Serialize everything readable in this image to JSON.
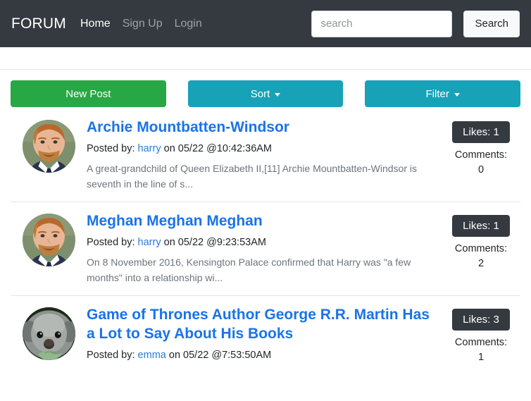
{
  "navbar": {
    "brand": "FORUM",
    "links": [
      {
        "label": "Home",
        "state": "active"
      },
      {
        "label": "Sign Up",
        "state": "muted"
      },
      {
        "label": "Login",
        "state": "muted"
      }
    ],
    "search": {
      "placeholder": "search",
      "value": "",
      "button_label": "Search"
    },
    "background_color": "#343a40"
  },
  "actions": {
    "new_post_label": "New Post",
    "sort_label": "Sort",
    "filter_label": "Filter",
    "new_post_color": "#28a745",
    "sort_color": "#17a2b8",
    "filter_color": "#17a2b8"
  },
  "posts": [
    {
      "title": "Archie Mountbatten-Windsor",
      "posted_by_label": "Posted by:",
      "author": "harry",
      "date_text": "on 05/22 @10:42:36AM",
      "excerpt": "A great-grandchild of Queen Elizabeth II,[11] Archie Mountbatten-Windsor is seventh in the line of s...",
      "likes_label": "Likes: 1",
      "comments_label": "Comments:",
      "comments_count": "0",
      "avatar": "prince-harry-photo"
    },
    {
      "title": "Meghan Meghan Meghan",
      "posted_by_label": "Posted by:",
      "author": "harry",
      "date_text": "on 05/22 @9:23:53AM",
      "excerpt": "On 8 November 2016, Kensington Palace confirmed that Harry was \"a few months\" into a relationship wi...",
      "likes_label": "Likes: 1",
      "comments_label": "Comments:",
      "comments_count": "2",
      "avatar": "prince-harry-photo"
    },
    {
      "title": "Game of Thrones Author George R.R. Martin Has a Lot to Say About His Books",
      "posted_by_label": "Posted by:",
      "author": "emma",
      "date_text": "on 05/22 @7:53:50AM",
      "excerpt": "",
      "likes_label": "Likes: 3",
      "comments_label": "Comments:",
      "comments_count": "1",
      "avatar": "koala-photo"
    }
  ]
}
